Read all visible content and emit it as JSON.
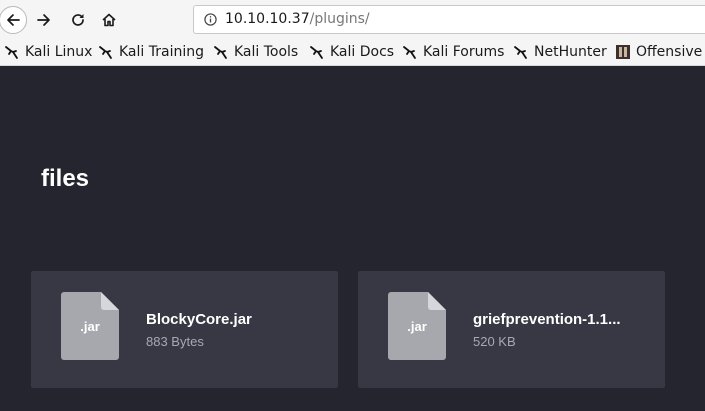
{
  "browser": {
    "url_host": "10.10.10.37",
    "url_path": "/plugins/",
    "icons": [
      "back-icon",
      "forward-icon",
      "reload-icon",
      "home-icon",
      "info-icon"
    ]
  },
  "bookmarks": [
    {
      "label": "Kali Linux",
      "icon": "kali-dragon-icon"
    },
    {
      "label": "Kali Training",
      "icon": "kali-dragon-icon"
    },
    {
      "label": "Kali Tools",
      "icon": "kali-dragon-icon"
    },
    {
      "label": "Kali Docs",
      "icon": "kali-dragon-icon"
    },
    {
      "label": "Kali Forums",
      "icon": "kali-dragon-icon"
    },
    {
      "label": "NetHunter",
      "icon": "kali-dragon-icon"
    },
    {
      "label": "Offensive Security",
      "icon": "offsec-icon"
    }
  ],
  "page": {
    "heading": "files",
    "files": [
      {
        "ext": ".jar",
        "name": "BlockyCore.jar",
        "size": "883 Bytes"
      },
      {
        "ext": ".jar",
        "name": "griefprevention-1.1...",
        "size": "520 KB"
      }
    ]
  },
  "colors": {
    "page_background": "#24252e",
    "card_background": "#383844",
    "file_icon": "#a7a8ae"
  }
}
